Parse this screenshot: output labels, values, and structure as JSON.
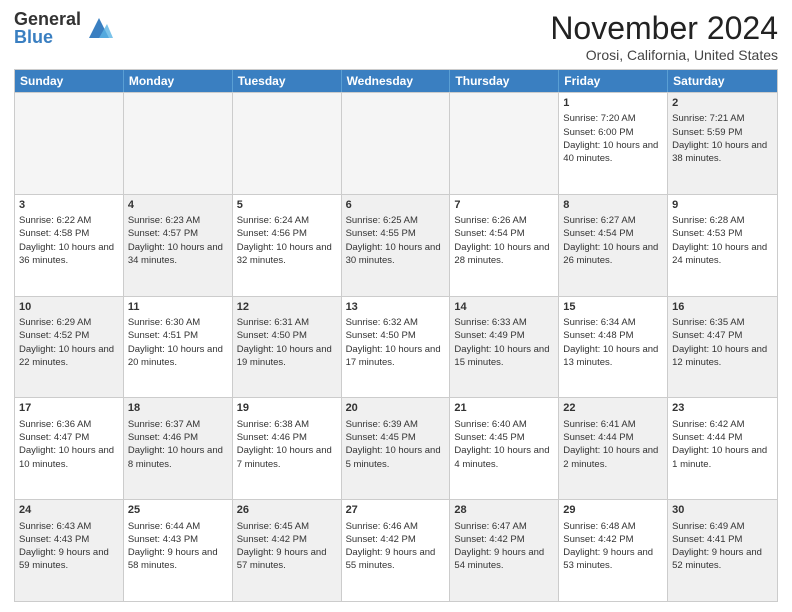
{
  "logo": {
    "general": "General",
    "blue": "Blue"
  },
  "header": {
    "month": "November 2024",
    "location": "Orosi, California, United States"
  },
  "weekdays": [
    "Sunday",
    "Monday",
    "Tuesday",
    "Wednesday",
    "Thursday",
    "Friday",
    "Saturday"
  ],
  "rows": [
    [
      {
        "day": "",
        "info": "",
        "empty": true
      },
      {
        "day": "",
        "info": "",
        "empty": true
      },
      {
        "day": "",
        "info": "",
        "empty": true
      },
      {
        "day": "",
        "info": "",
        "empty": true
      },
      {
        "day": "",
        "info": "",
        "empty": true
      },
      {
        "day": "1",
        "info": "Sunrise: 7:20 AM\nSunset: 6:00 PM\nDaylight: 10 hours and 40 minutes.",
        "empty": false,
        "shaded": false
      },
      {
        "day": "2",
        "info": "Sunrise: 7:21 AM\nSunset: 5:59 PM\nDaylight: 10 hours and 38 minutes.",
        "empty": false,
        "shaded": true
      }
    ],
    [
      {
        "day": "3",
        "info": "Sunrise: 6:22 AM\nSunset: 4:58 PM\nDaylight: 10 hours and 36 minutes.",
        "empty": false,
        "shaded": false
      },
      {
        "day": "4",
        "info": "Sunrise: 6:23 AM\nSunset: 4:57 PM\nDaylight: 10 hours and 34 minutes.",
        "empty": false,
        "shaded": true
      },
      {
        "day": "5",
        "info": "Sunrise: 6:24 AM\nSunset: 4:56 PM\nDaylight: 10 hours and 32 minutes.",
        "empty": false,
        "shaded": false
      },
      {
        "day": "6",
        "info": "Sunrise: 6:25 AM\nSunset: 4:55 PM\nDaylight: 10 hours and 30 minutes.",
        "empty": false,
        "shaded": true
      },
      {
        "day": "7",
        "info": "Sunrise: 6:26 AM\nSunset: 4:54 PM\nDaylight: 10 hours and 28 minutes.",
        "empty": false,
        "shaded": false
      },
      {
        "day": "8",
        "info": "Sunrise: 6:27 AM\nSunset: 4:54 PM\nDaylight: 10 hours and 26 minutes.",
        "empty": false,
        "shaded": true
      },
      {
        "day": "9",
        "info": "Sunrise: 6:28 AM\nSunset: 4:53 PM\nDaylight: 10 hours and 24 minutes.",
        "empty": false,
        "shaded": false
      }
    ],
    [
      {
        "day": "10",
        "info": "Sunrise: 6:29 AM\nSunset: 4:52 PM\nDaylight: 10 hours and 22 minutes.",
        "empty": false,
        "shaded": true
      },
      {
        "day": "11",
        "info": "Sunrise: 6:30 AM\nSunset: 4:51 PM\nDaylight: 10 hours and 20 minutes.",
        "empty": false,
        "shaded": false
      },
      {
        "day": "12",
        "info": "Sunrise: 6:31 AM\nSunset: 4:50 PM\nDaylight: 10 hours and 19 minutes.",
        "empty": false,
        "shaded": true
      },
      {
        "day": "13",
        "info": "Sunrise: 6:32 AM\nSunset: 4:50 PM\nDaylight: 10 hours and 17 minutes.",
        "empty": false,
        "shaded": false
      },
      {
        "day": "14",
        "info": "Sunrise: 6:33 AM\nSunset: 4:49 PM\nDaylight: 10 hours and 15 minutes.",
        "empty": false,
        "shaded": true
      },
      {
        "day": "15",
        "info": "Sunrise: 6:34 AM\nSunset: 4:48 PM\nDaylight: 10 hours and 13 minutes.",
        "empty": false,
        "shaded": false
      },
      {
        "day": "16",
        "info": "Sunrise: 6:35 AM\nSunset: 4:47 PM\nDaylight: 10 hours and 12 minutes.",
        "empty": false,
        "shaded": true
      }
    ],
    [
      {
        "day": "17",
        "info": "Sunrise: 6:36 AM\nSunset: 4:47 PM\nDaylight: 10 hours and 10 minutes.",
        "empty": false,
        "shaded": false
      },
      {
        "day": "18",
        "info": "Sunrise: 6:37 AM\nSunset: 4:46 PM\nDaylight: 10 hours and 8 minutes.",
        "empty": false,
        "shaded": true
      },
      {
        "day": "19",
        "info": "Sunrise: 6:38 AM\nSunset: 4:46 PM\nDaylight: 10 hours and 7 minutes.",
        "empty": false,
        "shaded": false
      },
      {
        "day": "20",
        "info": "Sunrise: 6:39 AM\nSunset: 4:45 PM\nDaylight: 10 hours and 5 minutes.",
        "empty": false,
        "shaded": true
      },
      {
        "day": "21",
        "info": "Sunrise: 6:40 AM\nSunset: 4:45 PM\nDaylight: 10 hours and 4 minutes.",
        "empty": false,
        "shaded": false
      },
      {
        "day": "22",
        "info": "Sunrise: 6:41 AM\nSunset: 4:44 PM\nDaylight: 10 hours and 2 minutes.",
        "empty": false,
        "shaded": true
      },
      {
        "day": "23",
        "info": "Sunrise: 6:42 AM\nSunset: 4:44 PM\nDaylight: 10 hours and 1 minute.",
        "empty": false,
        "shaded": false
      }
    ],
    [
      {
        "day": "24",
        "info": "Sunrise: 6:43 AM\nSunset: 4:43 PM\nDaylight: 9 hours and 59 minutes.",
        "empty": false,
        "shaded": true
      },
      {
        "day": "25",
        "info": "Sunrise: 6:44 AM\nSunset: 4:43 PM\nDaylight: 9 hours and 58 minutes.",
        "empty": false,
        "shaded": false
      },
      {
        "day": "26",
        "info": "Sunrise: 6:45 AM\nSunset: 4:42 PM\nDaylight: 9 hours and 57 minutes.",
        "empty": false,
        "shaded": true
      },
      {
        "day": "27",
        "info": "Sunrise: 6:46 AM\nSunset: 4:42 PM\nDaylight: 9 hours and 55 minutes.",
        "empty": false,
        "shaded": false
      },
      {
        "day": "28",
        "info": "Sunrise: 6:47 AM\nSunset: 4:42 PM\nDaylight: 9 hours and 54 minutes.",
        "empty": false,
        "shaded": true
      },
      {
        "day": "29",
        "info": "Sunrise: 6:48 AM\nSunset: 4:42 PM\nDaylight: 9 hours and 53 minutes.",
        "empty": false,
        "shaded": false
      },
      {
        "day": "30",
        "info": "Sunrise: 6:49 AM\nSunset: 4:41 PM\nDaylight: 9 hours and 52 minutes.",
        "empty": false,
        "shaded": true
      }
    ]
  ]
}
